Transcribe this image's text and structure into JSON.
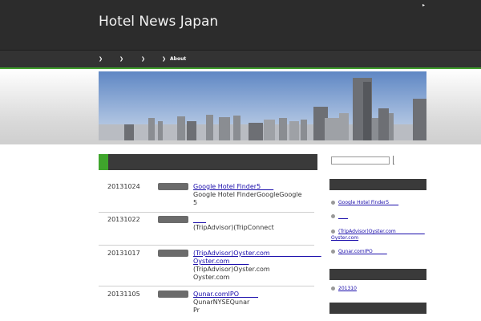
{
  "header": {
    "title": "Hotel News Japan",
    "accent_glyph": "▸"
  },
  "nav": {
    "chevron": "❯",
    "items": [
      {
        "label": ""
      },
      {
        "label": ""
      },
      {
        "label": ""
      },
      {
        "label": "About"
      }
    ]
  },
  "main": {
    "posts": [
      {
        "date": "20131024",
        "title": "Google Hotel Finder5　　",
        "desc": "Google Hotel FinderGoogleGoogle\n5"
      },
      {
        "date": "20131022",
        "title": "　　",
        "desc": "(TripAdvisor)(TripConnect"
      },
      {
        "date": "20131017",
        "title": "(TripAdvisor)Oyster.com　　　　　　　　\nOyster.com　　　",
        "desc": "(TripAdvisor)Oyster.com\nOyster.com"
      },
      {
        "date": "20131105",
        "title": "Qunar.comIPO　　　",
        "desc": "QunarNYSEQunar\nPr"
      }
    ]
  },
  "sidebar": {
    "links": [
      {
        "label": "Google Hotel Finder5　　"
      },
      {
        "label": "　　"
      },
      {
        "label": "(TripAdvisor)Oyster.com　　　　　　\nOyster.com"
      },
      {
        "label": "Qunar.comIPO　　　"
      }
    ],
    "archives": [
      {
        "label": "201310"
      }
    ]
  },
  "colors": {
    "header_bg": "#2c2c2c",
    "nav_bg": "#333333",
    "accent_green": "#3f9d2b",
    "link": "#1a0dab"
  }
}
